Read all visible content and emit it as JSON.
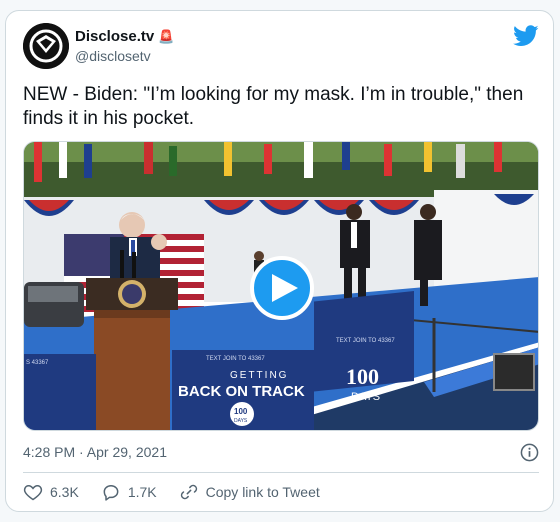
{
  "account": {
    "display_name": "Disclose.tv",
    "handle": "@disclosetv",
    "badge_icon": "siren-icon",
    "avatar_icon": "disclose-logo-icon"
  },
  "tweet": {
    "text": "NEW - Biden: \"I’m looking for my mask. I’m in trouble,\" then finds it in his pocket.",
    "timestamp": "4:28 PM · Apr 29, 2021"
  },
  "media": {
    "type": "video",
    "play_icon": "play-icon",
    "signs": {
      "left_small": "TEXT JOIN TO 43367",
      "left_main_1": "GETTING",
      "left_main_2": "BACK ON TRACK",
      "left_seal": "100",
      "left_seal_sub": "DAYS",
      "right_small": "TEXT JOIN TO 43367",
      "right_big": "100",
      "right_sub": "DAYS",
      "far_left_small": "S 43367"
    }
  },
  "actions": {
    "likes": "6.3K",
    "replies": "1.7K",
    "copy_link": "Copy link to Tweet"
  },
  "colors": {
    "accent": "#1d9bf0",
    "text_secondary": "#536471",
    "border": "#cfd9de",
    "stage_blue": "#2f6fc9"
  }
}
